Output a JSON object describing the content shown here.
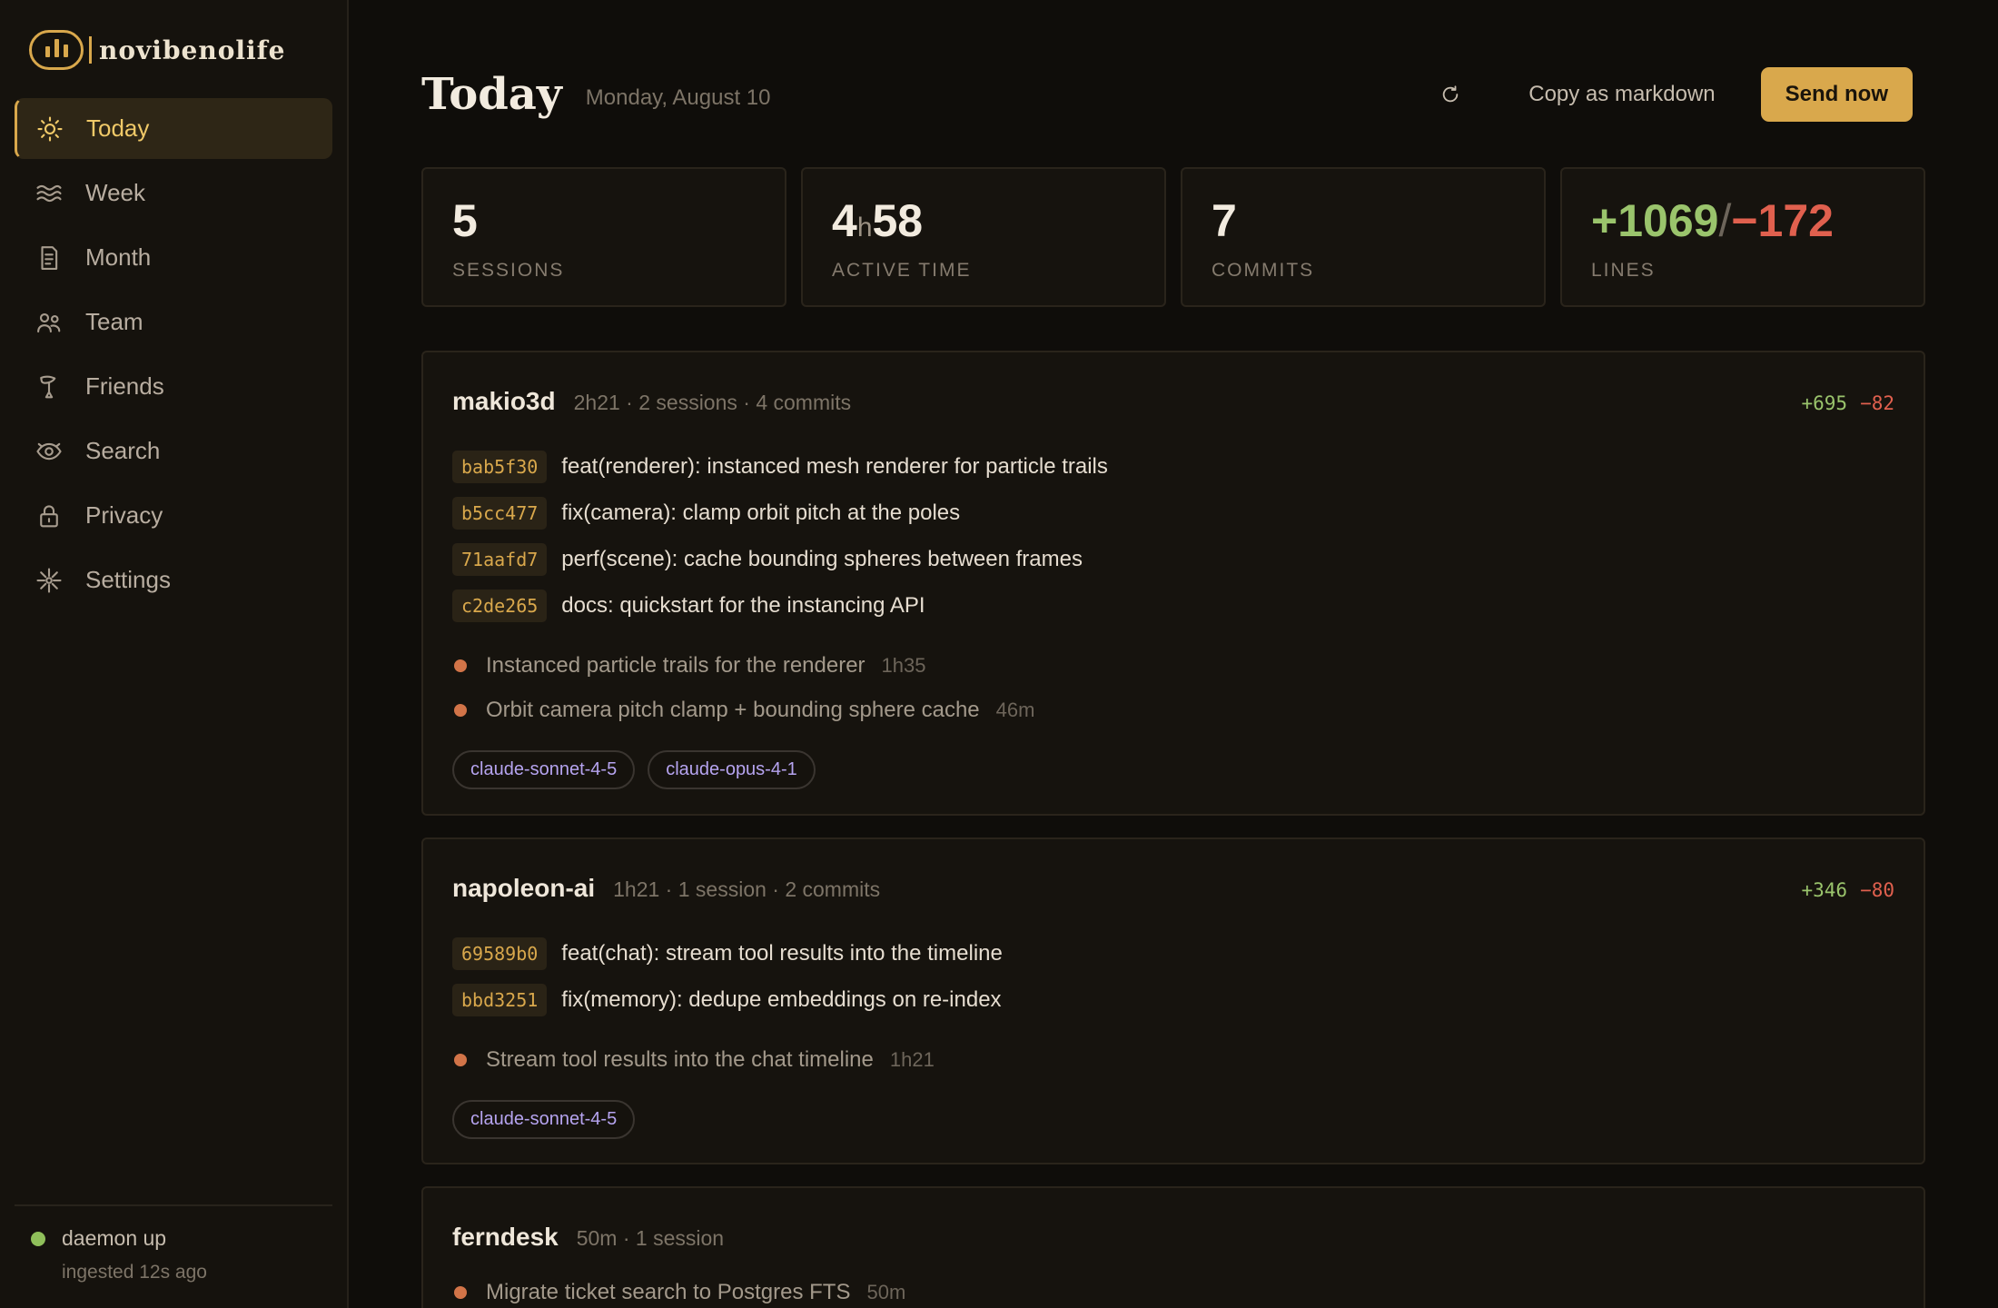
{
  "app": {
    "name": "novibenolife"
  },
  "sidebar": {
    "items": [
      {
        "label": "Today",
        "icon": "sun-icon",
        "active": true
      },
      {
        "label": "Week",
        "icon": "waves-icon"
      },
      {
        "label": "Month",
        "icon": "document-icon"
      },
      {
        "label": "Team",
        "icon": "people-icon"
      },
      {
        "label": "Friends",
        "icon": "hand-wave-icon"
      },
      {
        "label": "Search",
        "icon": "eye-icon"
      },
      {
        "label": "Privacy",
        "icon": "lock-icon"
      },
      {
        "label": "Settings",
        "icon": "sparkle-icon"
      }
    ],
    "status": {
      "label": "daemon up",
      "sub": "ingested 12s ago",
      "color": "#8fbf5a"
    }
  },
  "header": {
    "title": "Today",
    "date": "Monday, August 10",
    "copy_label": "Copy as markdown",
    "send_label": "Send now"
  },
  "stats": {
    "sessions": {
      "value": "5",
      "label": "SESSIONS"
    },
    "active_time": {
      "hours": "4",
      "hour_unit": "h",
      "minutes": "58",
      "label": "ACTIVE TIME"
    },
    "commits": {
      "value": "7",
      "label": "COMMITS"
    },
    "lines": {
      "added": "+1069",
      "separator": "/",
      "removed": "−172",
      "label": "LINES"
    }
  },
  "projects": [
    {
      "name": "makio3d",
      "meta": "2h21 · 2 sessions · 4 commits",
      "added": "+695",
      "removed": "−82",
      "commits": [
        {
          "hash": "bab5f30",
          "message": "feat(renderer): instanced mesh renderer for particle trails"
        },
        {
          "hash": "b5cc477",
          "message": "fix(camera): clamp orbit pitch at the poles"
        },
        {
          "hash": "71aafd7",
          "message": "perf(scene): cache bounding spheres between frames"
        },
        {
          "hash": "c2de265",
          "message": "docs: quickstart for the instancing API"
        }
      ],
      "sessions": [
        {
          "title": "Instanced particle trails for the renderer",
          "duration": "1h35"
        },
        {
          "title": "Orbit camera pitch clamp + bounding sphere cache",
          "duration": "46m"
        }
      ],
      "models": [
        "claude-sonnet-4-5",
        "claude-opus-4-1"
      ]
    },
    {
      "name": "napoleon-ai",
      "meta": "1h21 · 1 session · 2 commits",
      "added": "+346",
      "removed": "−80",
      "commits": [
        {
          "hash": "69589b0",
          "message": "feat(chat): stream tool results into the timeline"
        },
        {
          "hash": "bbd3251",
          "message": "fix(memory): dedupe embeddings on re-index"
        }
      ],
      "sessions": [
        {
          "title": "Stream tool results into the chat timeline",
          "duration": "1h21"
        }
      ],
      "models": [
        "claude-sonnet-4-5"
      ]
    },
    {
      "name": "ferndesk",
      "meta": "50m · 1 session",
      "sessions": [
        {
          "title": "Migrate ticket search to Postgres FTS",
          "duration": "50m"
        }
      ]
    }
  ],
  "colors": {
    "accent": "#d9a84c",
    "added": "#9ac46c",
    "removed": "#e0604e",
    "session_dot": "#d27448",
    "model_tag": "#b6a4f0"
  }
}
